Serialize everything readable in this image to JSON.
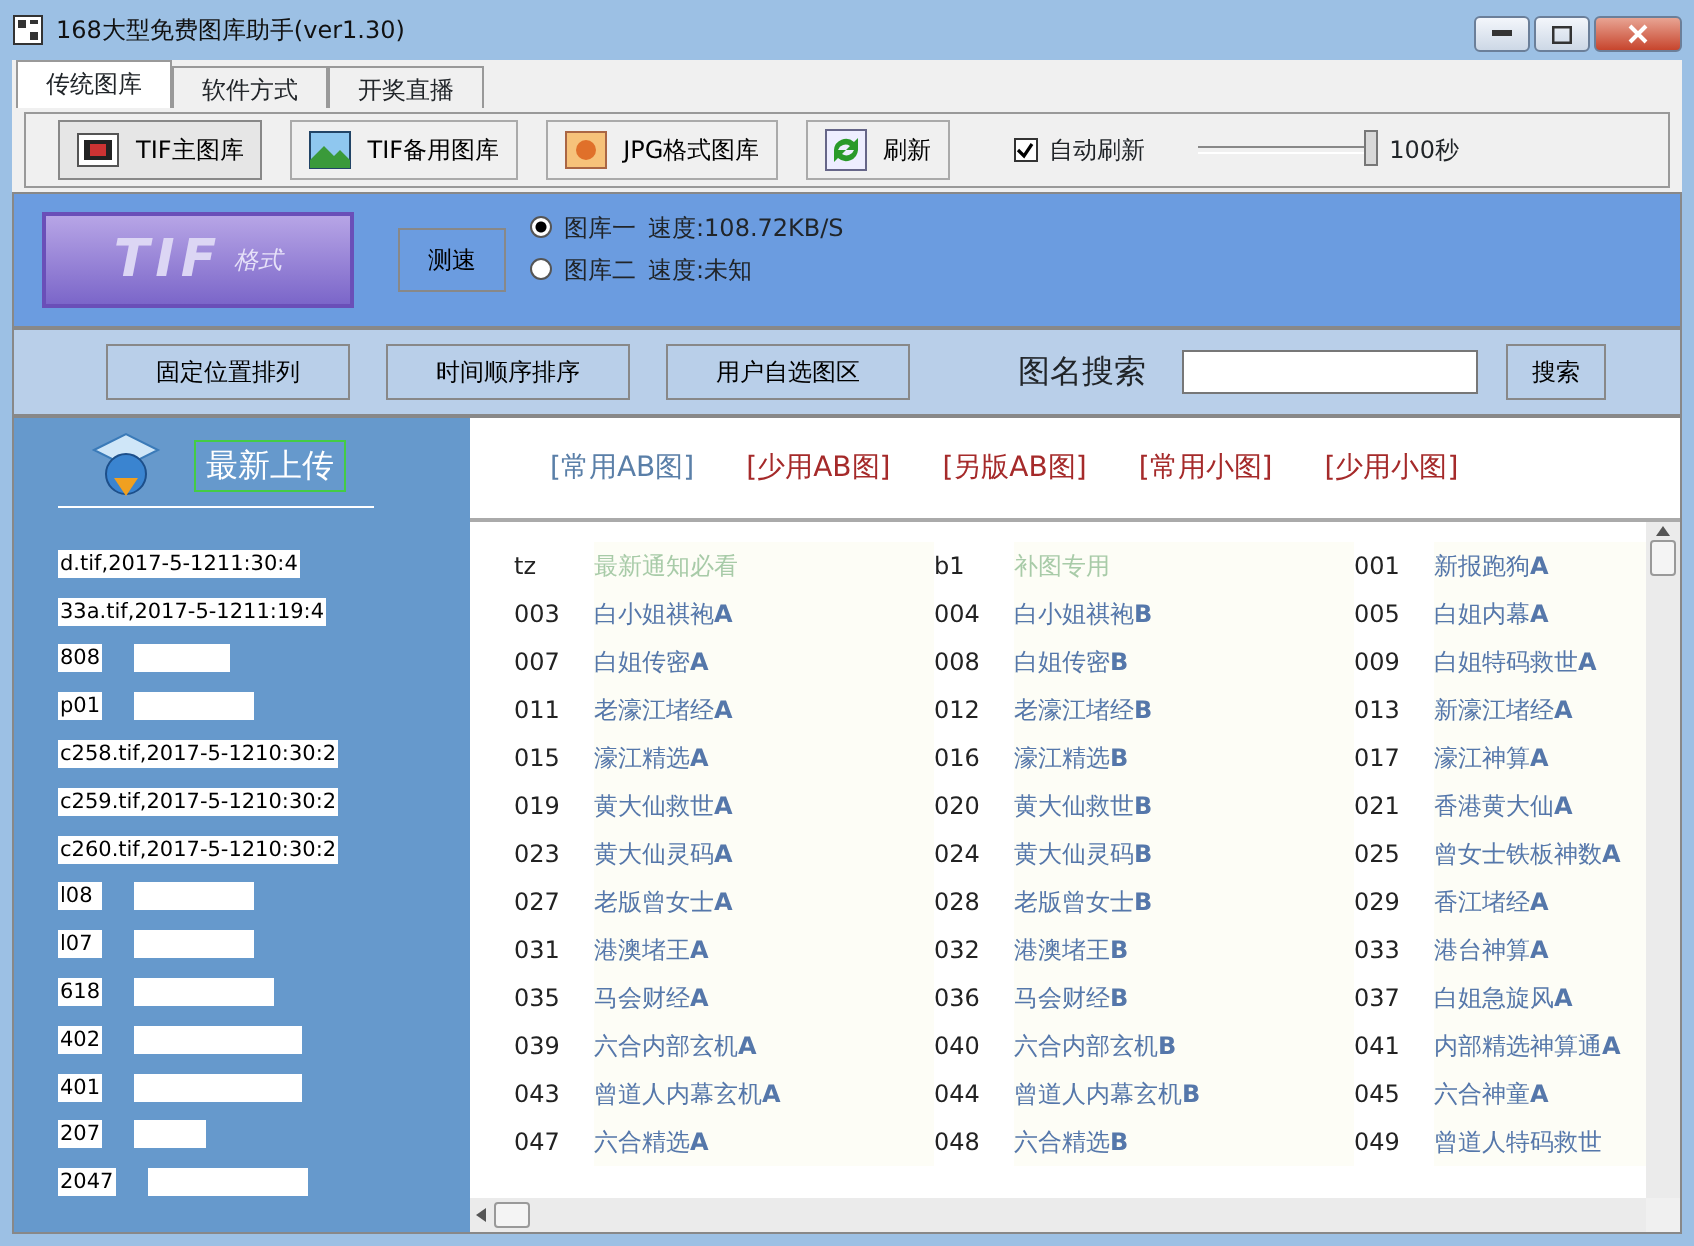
{
  "window": {
    "title": "168大型免费图库助手(ver1.30)"
  },
  "tabs": [
    {
      "label": "传统图库",
      "selected": true
    },
    {
      "label": "软件方式",
      "selected": false
    },
    {
      "label": "开奖直播",
      "selected": false
    }
  ],
  "toolbar": [
    {
      "label": "TIF主图库",
      "kind": "tif",
      "selected": true
    },
    {
      "label": "TIF备用图库",
      "kind": "landscape",
      "selected": false
    },
    {
      "label": "JPG格式图库",
      "kind": "jpg",
      "selected": false
    },
    {
      "label": "刷新",
      "kind": "refresh",
      "selected": false
    }
  ],
  "auto_refresh": {
    "label": "自动刷新",
    "checked": true,
    "level": 1,
    "reading": "100秒"
  },
  "logo": {
    "text": "TIF",
    "subtitle": "格式"
  },
  "speed": {
    "button": "测速",
    "servers": [
      {
        "name": "图库一",
        "speed": "速度:108.72KB/S",
        "selected": true
      },
      {
        "name": "图库二",
        "speed": "速度:未知",
        "selected": false
      }
    ]
  },
  "actions": [
    "固定位置排列",
    "时间顺序排序",
    "用户自选图区"
  ],
  "search": {
    "label": "图名搜索",
    "button": "搜索"
  },
  "sidebar": {
    "title": "最新上传",
    "items": [
      {
        "name": "d.tif,2017-5-1211:30:4",
        "kind": "file"
      },
      {
        "name": "33a.tif,2017-5-1211:19:4",
        "kind": "file"
      },
      {
        "name": "808",
        "kind": "code"
      },
      {
        "name": "p01",
        "kind": "code"
      },
      {
        "name": "c258.tif,2017-5-1210:30:2",
        "kind": "file"
      },
      {
        "name": "c259.tif,2017-5-1210:30:2",
        "kind": "file"
      },
      {
        "name": "c260.tif,2017-5-1210:30:2",
        "kind": "file"
      },
      {
        "name": "l08",
        "kind": "code"
      },
      {
        "name": "l07",
        "kind": "code"
      },
      {
        "name": "618",
        "kind": "code"
      },
      {
        "name": "402",
        "kind": "code"
      },
      {
        "name": "401",
        "kind": "code"
      },
      {
        "name": "207",
        "kind": "code"
      },
      {
        "name": "2047",
        "kind": "code"
      }
    ]
  },
  "categories": [
    {
      "label": "[常用AB图]",
      "selected": true
    },
    {
      "label": "[少用AB图]",
      "selected": false
    },
    {
      "label": "[另版AB图]",
      "selected": false
    },
    {
      "label": "[常用小图]",
      "selected": false
    },
    {
      "label": "[少用小图]",
      "selected": false
    }
  ],
  "entries": [
    {
      "code": "tz",
      "name": "最新通知必看",
      "kind": "notice"
    },
    {
      "code": "b1",
      "name": "补图专用",
      "kind": "notice"
    },
    {
      "code": "001",
      "name": "新报跑狗**A**",
      "kind": "chart"
    },
    {
      "code": "003",
      "name": "白小姐祺袍**A**",
      "kind": "chart"
    },
    {
      "code": "004",
      "name": "白小姐祺袍**B**",
      "kind": "chart"
    },
    {
      "code": "005",
      "name": "白姐内幕**A**",
      "kind": "chart"
    },
    {
      "code": "007",
      "name": "白姐传密**A**",
      "kind": "chart"
    },
    {
      "code": "008",
      "name": "白姐传密**B**",
      "kind": "chart"
    },
    {
      "code": "009",
      "name": "白姐特码救世**A**",
      "kind": "chart"
    },
    {
      "code": "011",
      "name": "老濠江堵经**A**",
      "kind": "chart"
    },
    {
      "code": "012",
      "name": "老濠江堵经**B**",
      "kind": "chart"
    },
    {
      "code": "013",
      "name": "新濠江堵经**A**",
      "kind": "chart"
    },
    {
      "code": "015",
      "name": "濠江精选**A**",
      "kind": "chart"
    },
    {
      "code": "016",
      "name": "濠江精选**B**",
      "kind": "chart"
    },
    {
      "code": "017",
      "name": "濠江神算**A**",
      "kind": "chart"
    },
    {
      "code": "019",
      "name": "黄大仙救世**A**",
      "kind": "chart"
    },
    {
      "code": "020",
      "name": "黄大仙救世**B**",
      "kind": "chart"
    },
    {
      "code": "021",
      "name": "香港黄大仙**A**",
      "kind": "chart"
    },
    {
      "code": "023",
      "name": "黄大仙灵码**A**",
      "kind": "chart"
    },
    {
      "code": "024",
      "name": "黄大仙灵码**B**",
      "kind": "chart"
    },
    {
      "code": "025",
      "name": "曾女士铁板神数**A**",
      "kind": "chart"
    },
    {
      "code": "027",
      "name": "老版曾女士**A**",
      "kind": "chart"
    },
    {
      "code": "028",
      "name": "老版曾女士**B**",
      "kind": "chart"
    },
    {
      "code": "029",
      "name": "香江堵经**A**",
      "kind": "chart"
    },
    {
      "code": "031",
      "name": "港澳堵王**A**",
      "kind": "chart"
    },
    {
      "code": "032",
      "name": "港澳堵王**B**",
      "kind": "chart"
    },
    {
      "code": "033",
      "name": "港台神算**A**",
      "kind": "chart"
    },
    {
      "code": "035",
      "name": "马会财经**A**",
      "kind": "chart"
    },
    {
      "code": "036",
      "name": "马会财经**B**",
      "kind": "chart"
    },
    {
      "code": "037",
      "name": "白姐急旋风**A**",
      "kind": "chart"
    },
    {
      "code": "039",
      "name": "六合内部玄机**A**",
      "kind": "chart"
    },
    {
      "code": "040",
      "name": "六合内部玄机**B**",
      "kind": "chart"
    },
    {
      "code": "041",
      "name": "内部精选神算通**A**",
      "kind": "chart"
    },
    {
      "code": "043",
      "name": "曾道人内幕玄机**A**",
      "kind": "chart"
    },
    {
      "code": "044",
      "name": "曾道人内幕玄机**B**",
      "kind": "chart"
    },
    {
      "code": "045",
      "name": "六合神童**A**",
      "kind": "chart"
    },
    {
      "code": "047",
      "name": "六合精选**A**",
      "kind": "chart"
    },
    {
      "code": "048",
      "name": "六合精选**B**",
      "kind": "chart"
    },
    {
      "code": "049",
      "name": "曾道人特码救世",
      "kind": "chart"
    }
  ]
}
